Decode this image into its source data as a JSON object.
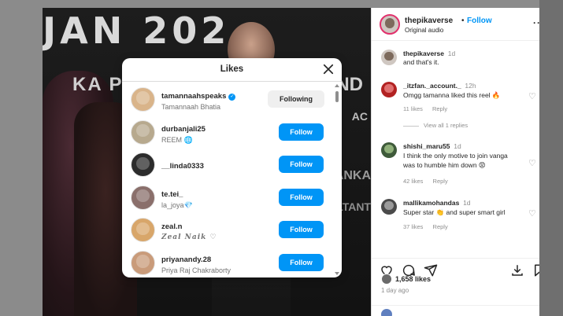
{
  "header": {
    "username": "thepikaverse",
    "separator": "•",
    "follow_label": "Follow",
    "audio": "Original audio",
    "more_label": "···"
  },
  "video": {
    "banner_main": "JAN 202",
    "banner_sub": "KA PA",
    "banner_d": "ND",
    "banner_r1": "AC",
    "banner_r2": "ANKA",
    "banner_r3": "LTANT"
  },
  "comments": [
    {
      "user": "thepikaverse",
      "time": "1d",
      "text": "and that's it.",
      "likes": "",
      "reply": "",
      "has_heart": false
    },
    {
      "user": "_itzfan._account._",
      "time": "12h",
      "text": "Omgg tamanna liked this reel 🔥",
      "likes": "11 likes",
      "reply": "Reply",
      "has_heart": true
    },
    {
      "user": "shishi_maru55",
      "time": "1d",
      "text": "I think the only motive to join vanga was to humble him down 😡",
      "likes": "42 likes",
      "reply": "Reply",
      "has_heart": true
    },
    {
      "user": "mallikamohandas",
      "time": "1d",
      "text": "Super star 👏 and super smart girl",
      "likes": "37 likes",
      "reply": "Reply",
      "has_heart": true
    }
  ],
  "view_replies": "View all 1 replies",
  "likes_count": "1,658 likes",
  "post_date": "1 day ago",
  "modal": {
    "title": "Likes",
    "rows": [
      {
        "username": "tamannaahspeaks",
        "name": "Tamannaah Bhatia",
        "verified": true,
        "button": "Following",
        "btn_style": "following",
        "avatar_color": "#d9b48a"
      },
      {
        "username": "durbanjali25",
        "name": "REEM 🌐",
        "verified": false,
        "button": "Follow",
        "btn_style": "follow",
        "avatar_color": "#b7a98e"
      },
      {
        "username": "__linda0333",
        "name": "",
        "verified": false,
        "button": "Follow",
        "btn_style": "follow",
        "avatar_color": "#2c2c2c"
      },
      {
        "username": "te.tei_",
        "name": "la_joya💎",
        "verified": false,
        "button": "Follow",
        "btn_style": "follow",
        "avatar_color": "#8a6f6b"
      },
      {
        "username": "zeal.n",
        "name": "Zeal Naik ♡",
        "verified": false,
        "button": "Follow",
        "btn_style": "follow",
        "avatar_color": "#d8a66a",
        "script_name": true
      },
      {
        "username": "priyanandy.28",
        "name": "Priya Raj Chakraborty",
        "verified": false,
        "button": "Follow",
        "btn_style": "follow",
        "avatar_color": "#c99b7a"
      }
    ]
  },
  "colors": {
    "accent": "#0095f6",
    "following_bg": "#efefef",
    "muted": "#8e8e8e"
  }
}
